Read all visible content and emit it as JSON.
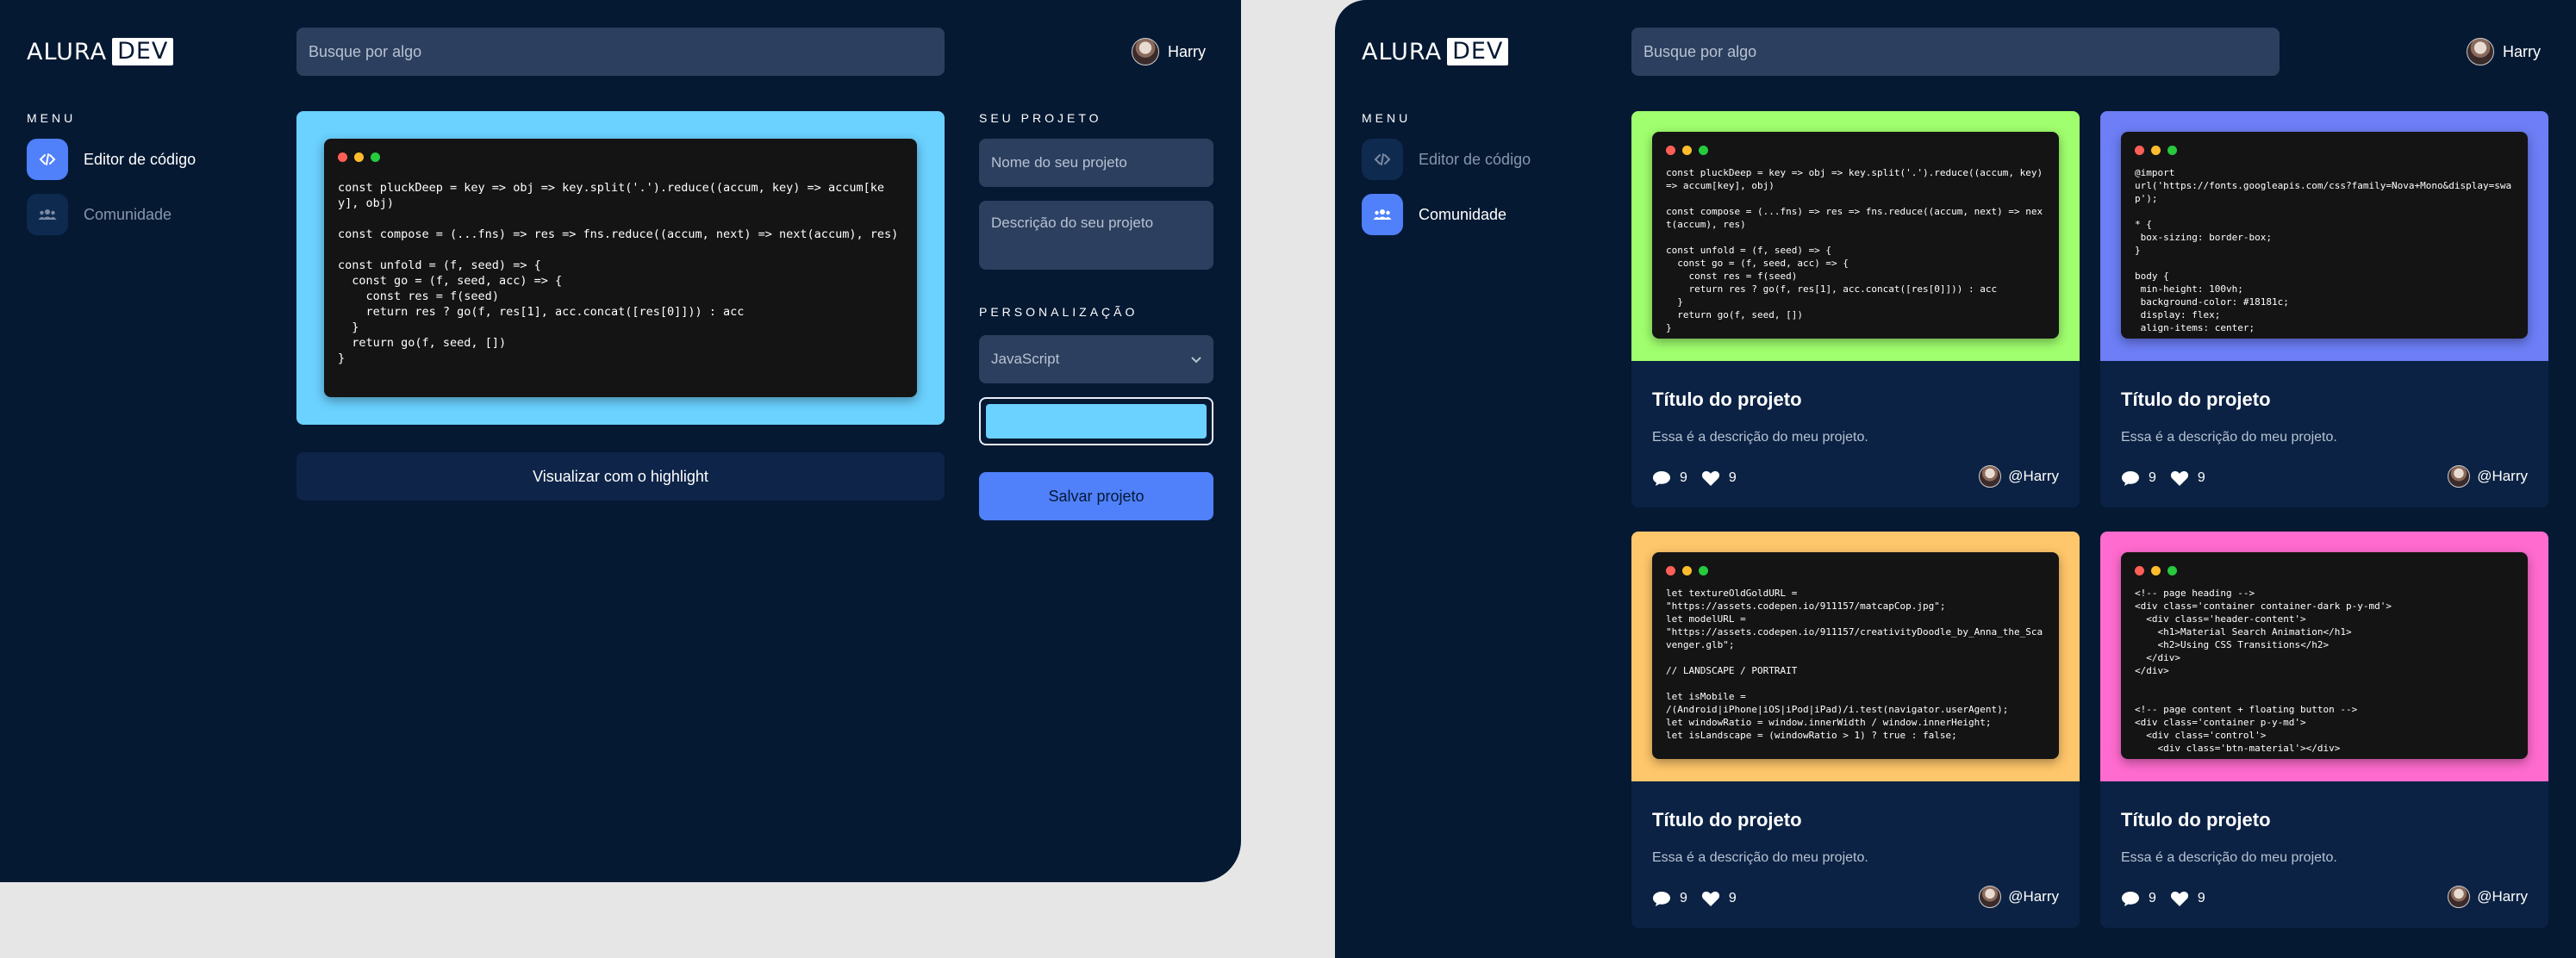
{
  "logo": {
    "primary": "ALURA",
    "badge": "DEV"
  },
  "search": {
    "placeholder": "Busque por algo"
  },
  "user": {
    "name": "Harry"
  },
  "menu": {
    "title": "MENU",
    "items": [
      {
        "label": "Editor de código",
        "icon": "code-icon"
      },
      {
        "label": "Comunidade",
        "icon": "users-icon"
      }
    ]
  },
  "editor": {
    "frame_color": "#6bd1ff",
    "code": "const pluckDeep = key => obj => key.split('.').reduce((accum, key) => accum[key], obj)\n\nconst compose = (...fns) => res => fns.reduce((accum, next) => next(accum), res)\n\nconst unfold = (f, seed) => {\n  const go = (f, seed, acc) => {\n    const res = f(seed)\n    return res ? go(f, res[1], acc.concat([res[0]])) : acc\n  }\n  return go(f, seed, [])\n}",
    "highlight_button": "Visualizar com o highlight"
  },
  "project": {
    "title": "SEU PROJETO",
    "name_placeholder": "Nome do seu projeto",
    "description_placeholder": "Descrição do seu projeto",
    "customization_title": "PERSONALIZAÇÃO",
    "language": "JavaScript",
    "color": "#6bd1ff",
    "save_button": "Salvar projeto"
  },
  "cards": [
    {
      "color": "#a0ff6e",
      "code": "const pluckDeep = key => obj => key.split('.').reduce((accum, key) => accum[key], obj)\n\nconst compose = (...fns) => res => fns.reduce((accum, next) => next(accum), res)\n\nconst unfold = (f, seed) => {\n  const go = (f, seed, acc) => {\n    const res = f(seed)\n    return res ? go(f, res[1], acc.concat([res[0]])) : acc\n  }\n  return go(f, seed, [])\n}",
      "title": "Título do projeto",
      "description": "Essa é a descrição do meu projeto.",
      "comments": "9",
      "likes": "9",
      "author": "@Harry"
    },
    {
      "color": "#6d7ef6",
      "code": "@import\nurl('https://fonts.googleapis.com/css?family=Nova+Mono&display=swap');\n\n* {\n box-sizing: border-box;\n}\n\nbody {\n min-height: 100vh;\n background-color: #18181c;\n display: flex;\n align-items: center;",
      "title": "Título do projeto",
      "description": "Essa é a descrição do meu projeto.",
      "comments": "9",
      "likes": "9",
      "author": "@Harry"
    },
    {
      "color": "#ffc76b",
      "code": "let textureOldGoldURL =\n\"https://assets.codepen.io/911157/matcapCop.jpg\";\nlet modelURL =\n\"https://assets.codepen.io/911157/creativityDoodle_by_Anna_the_Scavenger.glb\";\n\n// LANDSCAPE / PORTRAIT\n\nlet isMobile =\n/(Android|iPhone|iOS|iPod|iPad)/i.test(navigator.userAgent);\nlet windowRatio = window.innerWidth / window.innerHeight;\nlet isLandscape = (windowRatio > 1) ? true : false;",
      "title": "Título do projeto",
      "description": "Essa é a descrição do meu projeto.",
      "comments": "9",
      "likes": "9",
      "author": "@Harry"
    },
    {
      "color": "#ff6bcf",
      "code": "<!-- page heading -->\n<div class='container container-dark p-y-md'>\n  <div class='header-content'>\n    <h1>Material Search Animation</h1>\n    <h2>Using CSS Transitions</h2>\n  </div>\n</div>\n\n\n<!-- page content + floating button -->\n<div class='container p-y-md'>\n  <div class='control'>\n    <div class='btn-material'></div>",
      "title": "Título do projeto",
      "description": "Essa é a descrição do meu projeto.",
      "comments": "9",
      "likes": "9",
      "author": "@Harry"
    }
  ]
}
